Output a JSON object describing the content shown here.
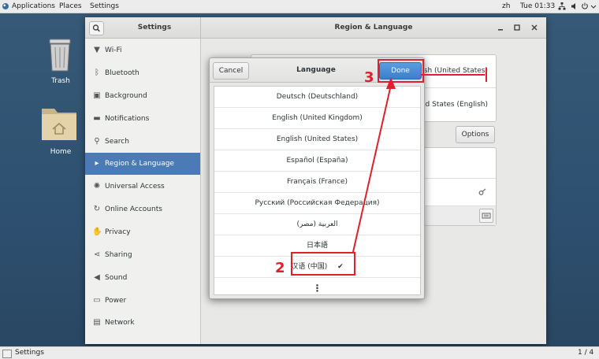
{
  "topbar": {
    "applications": "Applications",
    "places": "Places",
    "settings": "Settings",
    "input_method": "zh",
    "clock": "Tue 01:33"
  },
  "desktop": {
    "trash_label": "Trash",
    "home_label": "Home"
  },
  "settings_window": {
    "sidebar_title": "Settings",
    "panel_title": "Region & Language",
    "sidebar_items": [
      {
        "label": "Wi-Fi",
        "icon": "wifi-icon"
      },
      {
        "label": "Bluetooth",
        "icon": "bluetooth-icon"
      },
      {
        "label": "Background",
        "icon": "background-icon"
      },
      {
        "label": "Notifications",
        "icon": "notifications-icon"
      },
      {
        "label": "Search",
        "icon": "search-icon"
      },
      {
        "label": "Region & Language",
        "icon": "region-icon"
      },
      {
        "label": "Universal Access",
        "icon": "universal-access-icon"
      },
      {
        "label": "Online Accounts",
        "icon": "online-accounts-icon"
      },
      {
        "label": "Privacy",
        "icon": "privacy-icon"
      },
      {
        "label": "Sharing",
        "icon": "sharing-icon"
      },
      {
        "label": "Sound",
        "icon": "sound-icon"
      },
      {
        "label": "Power",
        "icon": "power-icon"
      },
      {
        "label": "Network",
        "icon": "network-icon"
      }
    ],
    "language_value": "English (United States)",
    "formats_value": "United States (English)",
    "options_label": "Options"
  },
  "language_dialog": {
    "title": "Language",
    "cancel_label": "Cancel",
    "done_label": "Done",
    "languages": [
      "Deutsch (Deutschland)",
      "English (United Kingdom)",
      "English (United States)",
      "Español (España)",
      "Français (France)",
      "Русский (Российская Федерация)",
      "العربية (مصر)",
      "日本語",
      "汉语 (中国)"
    ],
    "selected_mark": "✔",
    "more_glyph": "⋮"
  },
  "annotations": {
    "step2": "2",
    "step3": "3"
  },
  "bottombar": {
    "window_label": "Settings",
    "workspace": "1 / 4"
  },
  "colors": {
    "accent": "#4a7bb7",
    "annotation": "#e0202a"
  }
}
